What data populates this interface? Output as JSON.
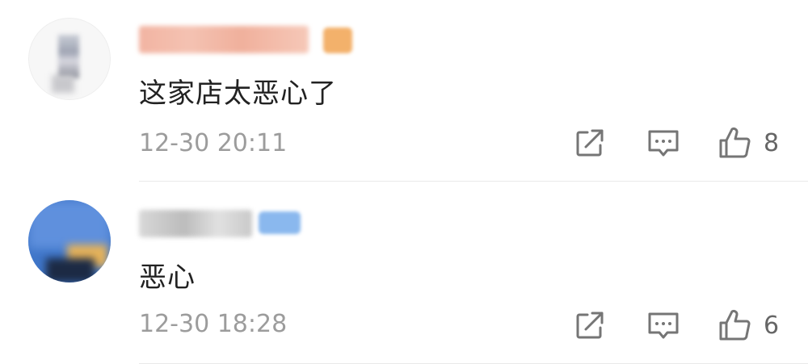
{
  "comments": [
    {
      "text": "这家店太恶心了",
      "time": "12-30 20:11",
      "likes": "8"
    },
    {
      "text": "恶心",
      "time": "12-30 18:28",
      "likes": "6"
    }
  ],
  "colors": {
    "text": "#222222",
    "meta": "#9c9c9c",
    "icon": "#757575",
    "divider": "#e9e9e9"
  },
  "icons": [
    "share-icon",
    "reply-icon",
    "like-icon"
  ]
}
